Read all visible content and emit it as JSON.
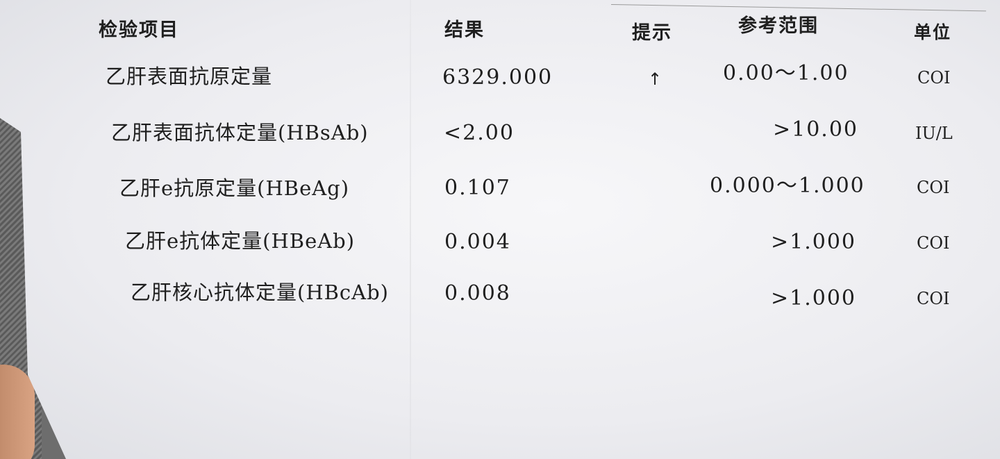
{
  "headers": {
    "item": "检验项目",
    "result": "结果",
    "flag": "提示",
    "range": "参考范围",
    "unit": "单位"
  },
  "rows": [
    {
      "item": "乙肝表面抗原定量",
      "result": "6329.000",
      "flag": "↑",
      "range": "0.00～1.00",
      "unit": "COI"
    },
    {
      "item": "乙肝表面抗体定量(HBsAb)",
      "result": "<2.00",
      "flag": "",
      "range": ">10.00",
      "unit": "IU/L"
    },
    {
      "item": "乙肝e抗原定量(HBeAg)",
      "result": "0.107",
      "flag": "",
      "range": "0.000～1.000",
      "unit": "COI"
    },
    {
      "item": "乙肝e抗体定量(HBeAb)",
      "result": "0.004",
      "flag": "",
      "range": ">1.000",
      "unit": "COI"
    },
    {
      "item": "乙肝核心抗体定量(HBcAb)",
      "result": "0.008",
      "flag": "",
      "range": ">1.000",
      "unit": "COI"
    }
  ]
}
